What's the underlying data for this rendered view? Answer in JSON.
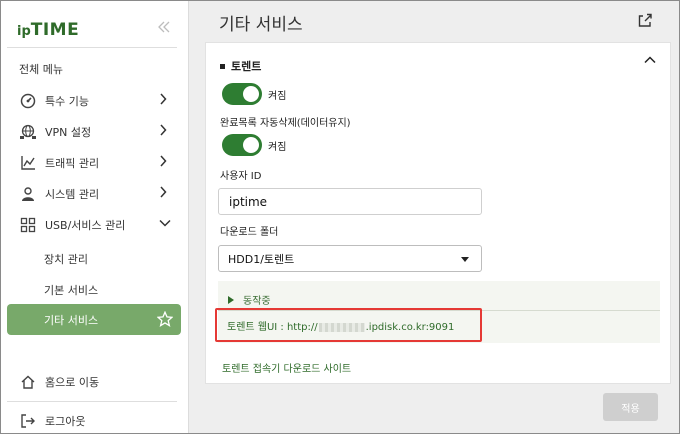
{
  "sidebar": {
    "logo": {
      "prefix": "ip",
      "name": "TIME"
    },
    "collapse_icon": "double-chevron-left-icon",
    "menu_title": "전체 메뉴",
    "items": [
      {
        "label": "특수 기능",
        "icon": "speedometer-icon",
        "chevron": "chevron-right-icon"
      },
      {
        "label": "VPN 설정",
        "icon": "globe-network-icon",
        "chevron": "chevron-right-icon"
      },
      {
        "label": "트래픽 관리",
        "icon": "line-chart-icon",
        "chevron": "chevron-right-icon"
      },
      {
        "label": "시스템 관리",
        "icon": "user-gear-icon",
        "chevron": "chevron-right-icon"
      },
      {
        "label": "USB/서비스 관리",
        "icon": "grid-apps-icon",
        "chevron": "chevron-down-icon"
      }
    ],
    "sub_items": [
      {
        "label": "장치 관리"
      },
      {
        "label": "기본 서비스"
      },
      {
        "label": "기타 서비스",
        "active": true
      }
    ],
    "home": {
      "label": "홈으로 이동",
      "icon": "home-icon"
    },
    "logout": {
      "label": "로그아웃",
      "icon": "logout-icon"
    }
  },
  "main": {
    "title": "기타 서비스",
    "torrent": {
      "section_title": "토렌트",
      "toggle_on_label": "켜짐",
      "auto_delete_label": "완료목록 자동삭제(데이터유지)",
      "auto_delete_on_label": "켜짐",
      "user_id_label": "사용자 ID",
      "user_id_value": "iptime",
      "download_folder_label": "다운로드 폴더",
      "download_folder_value": "HDD1/토렌트",
      "status_label": "동작중",
      "webui_prefix": "토렌트 웹UI : http://",
      "webui_suffix": ".ipdisk.co.kr:9091",
      "download_site_link": "토렌트 접속기 다운로드 사이트"
    },
    "apply_label": "적용"
  },
  "colors": {
    "accent_green": "#2e7d32",
    "active_item_bg": "#78a96a",
    "highlight_red": "#e53935"
  }
}
